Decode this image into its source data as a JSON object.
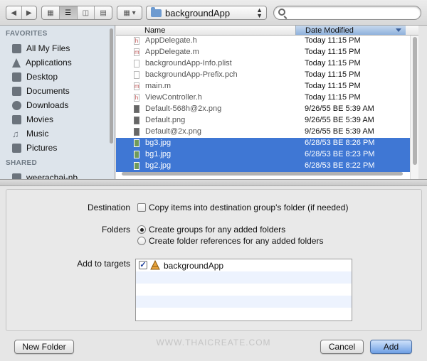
{
  "toolbar": {
    "back_icon": "chevron-left-icon",
    "forward_icon": "chevron-right-icon",
    "path_folder": "backgroundApp"
  },
  "sidebar": {
    "favorites_heading": "FAVORITES",
    "favorites": [
      {
        "label": "All My Files",
        "icon": "all-files-icon"
      },
      {
        "label": "Applications",
        "icon": "applications-icon"
      },
      {
        "label": "Desktop",
        "icon": "desktop-icon"
      },
      {
        "label": "Documents",
        "icon": "documents-icon"
      },
      {
        "label": "Downloads",
        "icon": "downloads-icon"
      },
      {
        "label": "Movies",
        "icon": "movies-icon"
      },
      {
        "label": "Music",
        "icon": "music-icon"
      },
      {
        "label": "Pictures",
        "icon": "pictures-icon"
      }
    ],
    "shared_heading": "SHARED",
    "shared": [
      {
        "label": "weerachai-nb",
        "icon": "computer-icon"
      }
    ]
  },
  "file_list": {
    "columns": [
      "Name",
      "Date Modified"
    ],
    "rows": [
      {
        "name": "AppDelegate.h",
        "date": "Today 11:15 PM",
        "type": "h",
        "selected": false
      },
      {
        "name": "AppDelegate.m",
        "date": "Today 11:15 PM",
        "type": "m",
        "selected": false
      },
      {
        "name": "backgroundApp-Info.plist",
        "date": "Today 11:15 PM",
        "type": "plist",
        "selected": false
      },
      {
        "name": "backgroundApp-Prefix.pch",
        "date": "Today 11:15 PM",
        "type": "pch",
        "selected": false
      },
      {
        "name": "main.m",
        "date": "Today 11:15 PM",
        "type": "m",
        "selected": false
      },
      {
        "name": "ViewController.h",
        "date": "Today 11:15 PM",
        "type": "h",
        "selected": false
      },
      {
        "name": "Default-568h@2x.png",
        "date": "9/26/55 BE 5:39 AM",
        "type": "png",
        "selected": false
      },
      {
        "name": "Default.png",
        "date": "9/26/55 BE 5:39 AM",
        "type": "png",
        "selected": false
      },
      {
        "name": "Default@2x.png",
        "date": "9/26/55 BE 5:39 AM",
        "type": "png",
        "selected": false
      },
      {
        "name": "bg3.jpg",
        "date": "6/28/53 BE 8:26 PM",
        "type": "jpg",
        "selected": true
      },
      {
        "name": "bg1.jpg",
        "date": "6/28/53 BE 8:23 PM",
        "type": "jpg",
        "selected": true
      },
      {
        "name": "bg2.jpg",
        "date": "6/28/53 BE 8:22 PM",
        "type": "jpg",
        "selected": true
      }
    ]
  },
  "options": {
    "destination_label": "Destination",
    "destination_checkbox": "Copy items into destination group's folder (if needed)",
    "destination_checked": false,
    "folders_label": "Folders",
    "folder_option_groups": "Create groups for any added folders",
    "folder_option_references": "Create folder references for any added folders",
    "folders_selected": "groups",
    "targets_label": "Add to targets",
    "targets": [
      {
        "name": "backgroundApp",
        "checked": true,
        "icon": "app-target-icon"
      }
    ]
  },
  "watermark": "WWW.THAICREATE.COM",
  "buttons": {
    "new_folder": "New Folder",
    "cancel": "Cancel",
    "add": "Add"
  }
}
